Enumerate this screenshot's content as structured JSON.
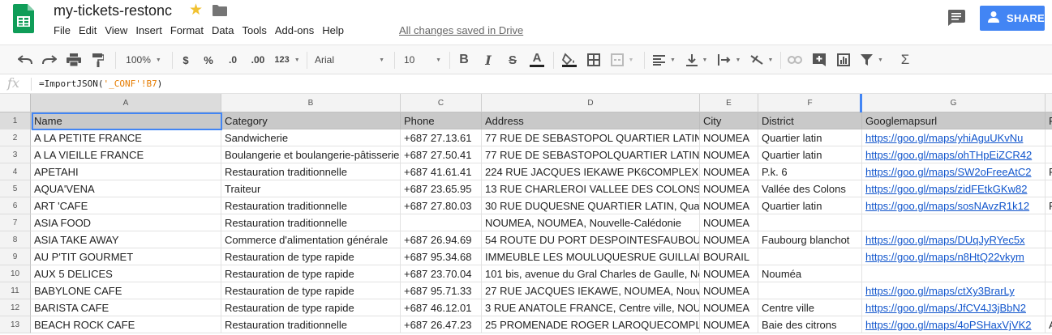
{
  "doc": {
    "title": "my-tickets-restonc",
    "saved_status": "All changes saved in Drive",
    "share_label": "SHARE"
  },
  "menu": [
    "File",
    "Edit",
    "View",
    "Insert",
    "Format",
    "Data",
    "Tools",
    "Add-ons",
    "Help"
  ],
  "toolbar": {
    "zoom": "100%",
    "currency": "$",
    "percent": "%",
    "dec_less": ".0",
    "dec_more": ".00",
    "more_formats": "123",
    "font": "Arial",
    "font_size": "10"
  },
  "formula_bar": {
    "fx": "fx",
    "formula_prefix": "=ImportJSON(",
    "formula_ref": "'_CONF'!B7",
    "formula_suffix": ")"
  },
  "sheet": {
    "active_cell": "A1",
    "column_letters": [
      "A",
      "B",
      "C",
      "D",
      "E",
      "F",
      "G",
      ""
    ],
    "row_numbers": [
      "1",
      "2",
      "3",
      "4",
      "5",
      "6",
      "7",
      "8",
      "9",
      "10",
      "11",
      "12",
      "13"
    ],
    "rows": [
      [
        "Name",
        "Category",
        "Phone",
        "Address",
        "City",
        "District",
        "Googlemapsurl",
        "F"
      ],
      [
        "A LA PETITE FRANCE",
        "Sandwicherie",
        "+687 27.13.61",
        "77 RUE DE SEBASTOPOL QUARTIER LATIN",
        "NOUMEA",
        "Quartier latin",
        "https://goo.gl/maps/yhiAguUKvNu",
        ""
      ],
      [
        "A LA VIEILLE FRANCE",
        "Boulangerie et boulangerie-pâtisserie",
        "+687 27.50.41",
        "77 RUE DE SEBASTOPOLQUARTIER LATIN,",
        "NOUMEA",
        "Quartier latin",
        "https://goo.gl/maps/ohTHpEiZCR42",
        ""
      ],
      [
        "APETAHI",
        "Restauration traditionnelle",
        "+687 41.61.41",
        "224 RUE JACQUES IEKAWE PK6COMPLEX",
        "NOUMEA",
        "P.k. 6",
        "https://goo.gl/maps/SW2oFreeAtC2",
        "F"
      ],
      [
        "AQUA'VENA",
        "Traiteur",
        "+687 23.65.95",
        "13 RUE CHARLEROI VALLEE DES COLONS",
        "NOUMEA",
        "Vallée des Colons",
        "https://goo.gl/maps/zidFEtkGKw82",
        ""
      ],
      [
        "ART 'CAFE",
        "Restauration traditionnelle",
        "+687 27.80.03",
        "30 RUE DUQUESNE QUARTIER LATIN, Qua",
        "NOUMEA",
        "Quartier latin",
        "https://goo.gl/maps/sosNAvzR1k12",
        "F"
      ],
      [
        "ASIA FOOD",
        "Restauration traditionnelle",
        "",
        "NOUMEA, NOUMEA, Nouvelle-Calédonie",
        "NOUMEA",
        "",
        "",
        ""
      ],
      [
        "ASIA TAKE AWAY",
        "Commerce d'alimentation générale",
        "+687 26.94.69",
        "54 ROUTE DU PORT DESPOINTESFAUBOU",
        "NOUMEA",
        "Faubourg blanchot",
        "https://goo.gl/maps/DUqJyRYec5x",
        ""
      ],
      [
        "AU P'TIT GOURMET",
        "Restauration de type rapide",
        "+687 95.34.68",
        "IMMEUBLE LES MOULUQUESRUE GUILLAI",
        "BOURAIL",
        "",
        "https://goo.gl/maps/n8HtQ22vkym",
        ""
      ],
      [
        "AUX 5 DELICES",
        "Restauration de type rapide",
        "+687 23.70.04",
        "101 bis, avenue du Gral Charles de Gaulle, No",
        "NOUMEA",
        "Nouméa",
        "",
        ""
      ],
      [
        "BABYLONE CAFE",
        "Restauration de type rapide",
        "+687 95.71.33",
        "27 RUE JACQUES IEKAWE, NOUMEA, Nouv",
        "NOUMEA",
        "",
        "https://goo.gl/maps/ctXy3BrarLy",
        ""
      ],
      [
        "BARISTA CAFE",
        "Restauration de type rapide",
        "+687 46.12.01",
        "3 RUE ANATOLE FRANCE, Centre ville, NOU",
        "NOUMEA",
        "Centre ville",
        "https://goo.gl/maps/JfCV4J3jBbN2",
        ""
      ],
      [
        "BEACH ROCK CAFE",
        "Restauration traditionnelle",
        "+687 26.47.23",
        "25 PROMENADE ROGER LAROQUECOMPL",
        "NOUMEA",
        "Baie des citrons",
        "https://goo.gl/maps/4oPSHaxVjVK2",
        "A"
      ]
    ]
  },
  "colors": {
    "share_blue": "#4285f4",
    "link_blue": "#1155cc",
    "sheets_green": "#0f9d58",
    "star_yellow": "#f1c232",
    "header_row_gray": "#c9c9c9"
  }
}
